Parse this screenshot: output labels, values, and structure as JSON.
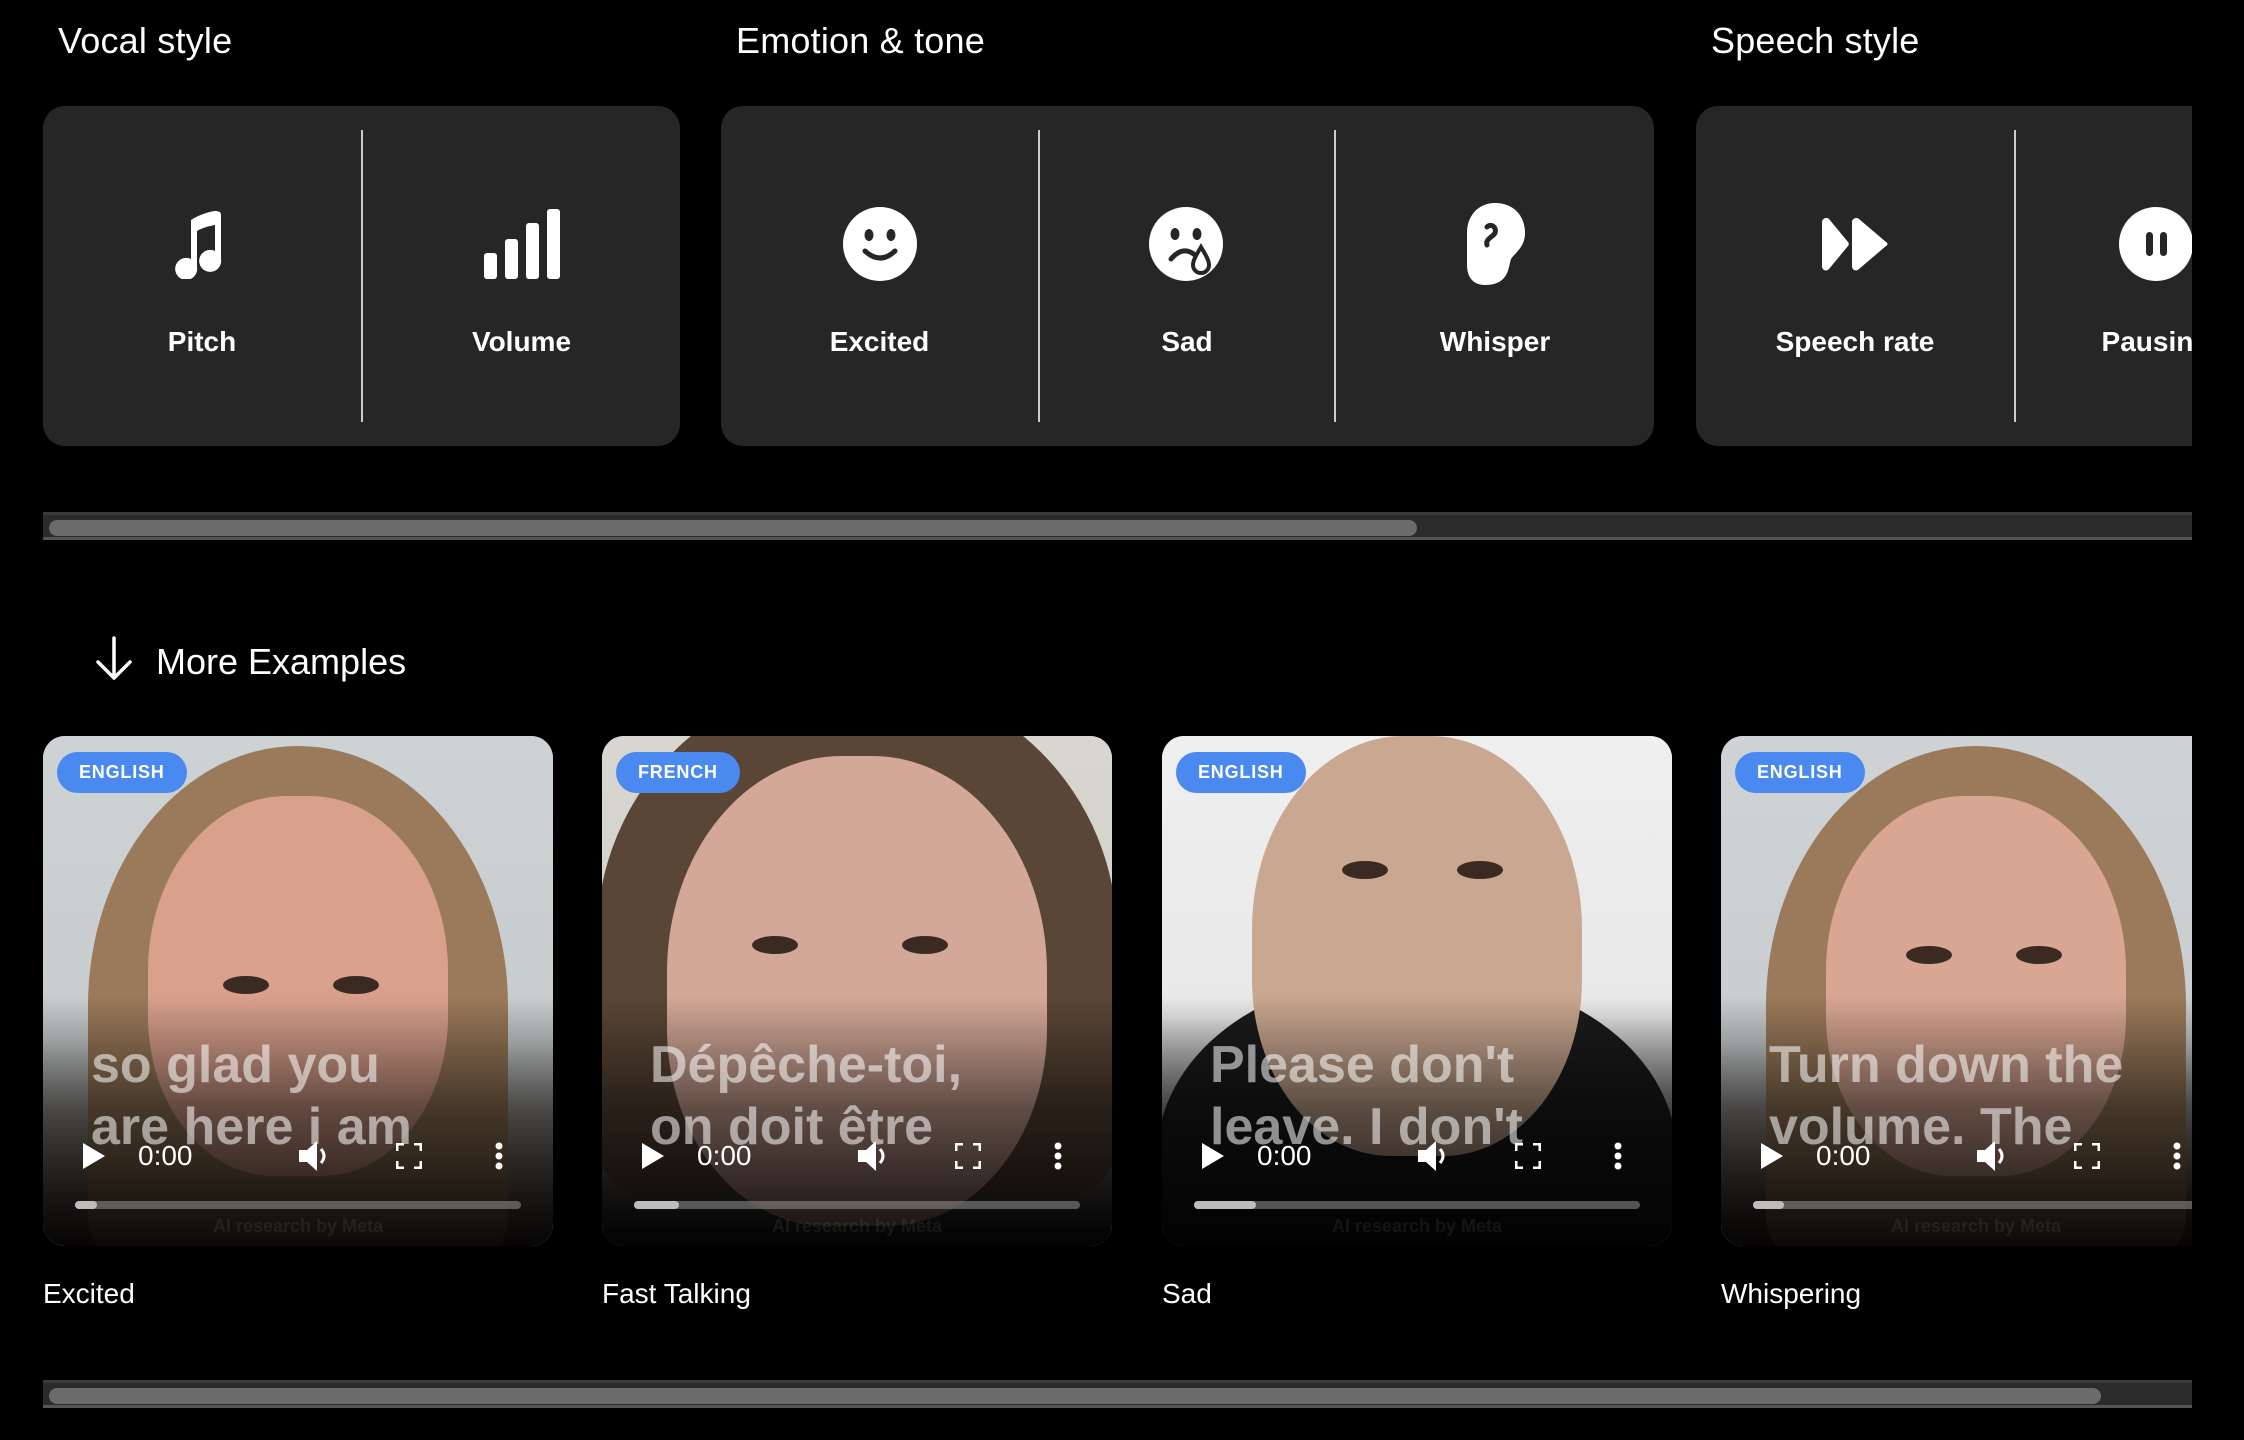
{
  "sections": [
    {
      "heading": "Vocal style",
      "features": [
        {
          "label": "Pitch",
          "icon": "music-note-icon"
        },
        {
          "label": "Volume",
          "icon": "volume-bars-icon"
        }
      ]
    },
    {
      "heading": "Emotion & tone",
      "features": [
        {
          "label": "Excited",
          "icon": "smiley-icon"
        },
        {
          "label": "Sad",
          "icon": "crying-face-icon"
        },
        {
          "label": "Whisper",
          "icon": "ear-icon"
        }
      ]
    },
    {
      "heading": "Speech style",
      "features": [
        {
          "label": "Speech rate",
          "icon": "fast-forward-icon"
        },
        {
          "label": "Pausing",
          "icon": "pause-circle-icon"
        }
      ]
    }
  ],
  "more_examples": {
    "label": "More Examples",
    "icon": "arrow-down-icon"
  },
  "videos": [
    {
      "language": "ENGLISH",
      "subtitle": "so glad you\nare here i am",
      "time": "0:00",
      "buffered": 0.05,
      "caption": "Excited",
      "watermark": "AI research by Meta"
    },
    {
      "language": "FRENCH",
      "subtitle": "Dépêche-toi,\non doit être",
      "time": "0:00",
      "buffered": 0.1,
      "caption": "Fast Talking",
      "watermark": "AI research by Meta"
    },
    {
      "language": "ENGLISH",
      "subtitle": "Please don't\nleave. I don't",
      "time": "0:00",
      "buffered": 0.14,
      "caption": "Sad",
      "watermark": "AI research by Meta"
    },
    {
      "language": "ENGLISH",
      "subtitle": "Turn down the\nvolume. The",
      "time": "0:00",
      "buffered": 0.07,
      "caption": "Whispering",
      "watermark": "AI research by Meta"
    }
  ],
  "scrollbars": {
    "features_thumb_fraction": 0.64,
    "videos_thumb_fraction": 0.96
  },
  "colors": {
    "badge": "#4a8af0",
    "panel": "#262626",
    "background": "#000000"
  }
}
